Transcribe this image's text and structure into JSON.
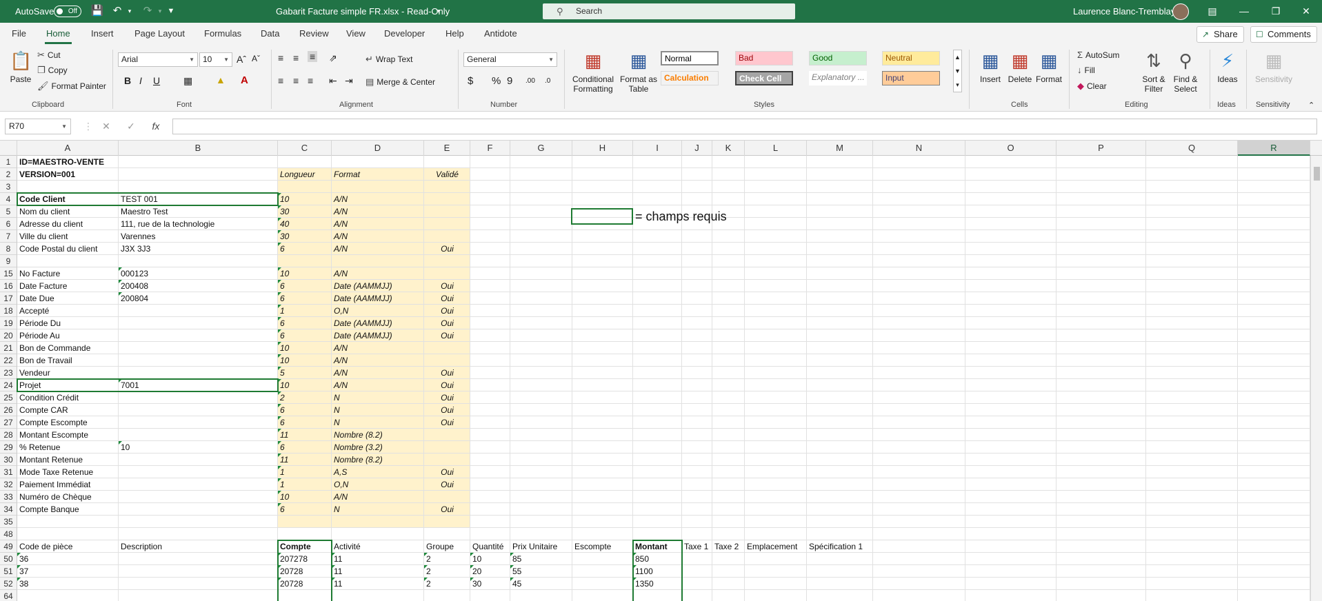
{
  "titlebar": {
    "autosave_label": "AutoSave",
    "autosave_state": "Off",
    "file_title": "Gabarit Facture simple FR.xlsx  -  Read-Only",
    "search_placeholder": "Search",
    "user_name": "Laurence Blanc-Tremblay"
  },
  "menu": {
    "tabs": [
      "File",
      "Home",
      "Insert",
      "Page Layout",
      "Formulas",
      "Data",
      "Review",
      "View",
      "Developer",
      "Help",
      "Antidote"
    ],
    "active": "Home",
    "share_label": "Share",
    "comments_label": "Comments"
  },
  "ribbon": {
    "clipboard": {
      "paste": "Paste",
      "cut": "Cut",
      "copy": "Copy",
      "format_painter": "Format Painter",
      "label": "Clipboard"
    },
    "font": {
      "family": "Arial",
      "size": "10",
      "label": "Font",
      "bold": "B",
      "italic": "I",
      "underline": "U"
    },
    "alignment": {
      "wrap_text": "Wrap Text",
      "merge_center": "Merge & Center",
      "label": "Alignment"
    },
    "number": {
      "format": "General",
      "label": "Number",
      "currency": "$",
      "percent": "%",
      "comma": "9",
      "inc_dec": ".00",
      "dec_dec": ".0"
    },
    "styles": {
      "conditional_formatting": "Conditional Formatting",
      "format_as_table": "Format as Table",
      "cells": [
        {
          "name": "Normal",
          "bg": "#ffffff",
          "color": "#000000"
        },
        {
          "name": "Bad",
          "bg": "#ffc7ce",
          "color": "#9c0006"
        },
        {
          "name": "Good",
          "bg": "#c6efce",
          "color": "#006100"
        },
        {
          "name": "Neutral",
          "bg": "#ffeb9c",
          "color": "#9c5700"
        },
        {
          "name": "Calculation",
          "bg": "#f2f2f2",
          "color": "#fa7d00"
        },
        {
          "name": "Check Cell",
          "bg": "#a5a5a5",
          "color": "#ffffff"
        },
        {
          "name": "Explanatory ...",
          "bg": "#ffffff",
          "color": "#7f7f7f"
        },
        {
          "name": "Input",
          "bg": "#ffcc99",
          "color": "#3f3f76"
        }
      ],
      "label": "Styles"
    },
    "cells": {
      "insert": "Insert",
      "delete": "Delete",
      "format": "Format",
      "label": "Cells"
    },
    "editing": {
      "autosum": "AutoSum",
      "fill": "Fill",
      "clear": "Clear",
      "sort_filter": "Sort & Filter",
      "find_select": "Find & Select",
      "label": "Editing"
    },
    "ideas": {
      "ideas": "Ideas",
      "label": "Ideas"
    },
    "sensitivity": {
      "sensitivity": "Sensitivity",
      "label": "Sensitivity"
    }
  },
  "formula_bar": {
    "name_box": "R70",
    "formula": ""
  },
  "columns": [
    "A",
    "B",
    "C",
    "D",
    "E",
    "F",
    "G",
    "H",
    "I",
    "J",
    "K",
    "L",
    "M",
    "N",
    "O",
    "P",
    "Q",
    "R"
  ],
  "selected_column": "R",
  "rows": [
    {
      "n": "1",
      "a": "ID=MAESTRO-VENTE",
      "ab": true
    },
    {
      "n": "2",
      "a": "VERSION=001",
      "ab": true,
      "c": "Longueur",
      "d": "Format",
      "e": "Validé"
    },
    {
      "n": "3"
    },
    {
      "n": "4",
      "a": "Code Client",
      "ab": true,
      "b": "TEST 001",
      "c": "10",
      "d": "A/N"
    },
    {
      "n": "5",
      "a": "Nom du client",
      "b": "Maestro Test",
      "c": "30",
      "d": "A/N"
    },
    {
      "n": "6",
      "a": "Adresse du client",
      "b": "111, rue de la technologie",
      "c": "40",
      "d": "A/N"
    },
    {
      "n": "7",
      "a": "Ville du client",
      "b": "Varennes",
      "c": "30",
      "d": "A/N"
    },
    {
      "n": "8",
      "a": "Code Postal du client",
      "b": "J3X 3J3",
      "c": "6",
      "d": "A/N",
      "e": "Oui"
    },
    {
      "n": "9"
    },
    {
      "n": "15",
      "a": "No Facture",
      "b": "000123",
      "bt": true,
      "c": "10",
      "d": "A/N"
    },
    {
      "n": "16",
      "a": "Date Facture",
      "b": "200408",
      "bt": true,
      "c": "6",
      "d": "Date (AAMMJJ)",
      "e": "Oui"
    },
    {
      "n": "17",
      "a": "Date Due",
      "b": "200804",
      "bt": true,
      "c": "6",
      "d": "Date (AAMMJJ)",
      "e": "Oui"
    },
    {
      "n": "18",
      "a": "Accepté",
      "c": "1",
      "d": "O,N",
      "e": "Oui"
    },
    {
      "n": "19",
      "a": "Période Du",
      "c": "6",
      "d": "Date (AAMMJJ)",
      "e": "Oui"
    },
    {
      "n": "20",
      "a": "Période Au",
      "c": "6",
      "d": "Date (AAMMJJ)",
      "e": "Oui"
    },
    {
      "n": "21",
      "a": "Bon de Commande",
      "c": "10",
      "d": "A/N"
    },
    {
      "n": "22",
      "a": "Bon de Travail",
      "c": "10",
      "d": "A/N"
    },
    {
      "n": "23",
      "a": "Vendeur",
      "c": "5",
      "d": "A/N",
      "e": "Oui"
    },
    {
      "n": "24",
      "a": "Projet",
      "b": "7001",
      "bt": true,
      "c": "10",
      "d": "A/N",
      "e": "Oui"
    },
    {
      "n": "25",
      "a": "Condition Crédit",
      "c": "2",
      "d": "N",
      "e": "Oui"
    },
    {
      "n": "26",
      "a": "Compte CAR",
      "c": "6",
      "d": "N",
      "e": "Oui"
    },
    {
      "n": "27",
      "a": "Compte Escompte",
      "c": "6",
      "d": "N",
      "e": "Oui"
    },
    {
      "n": "28",
      "a": "Montant Escompte",
      "c": "11",
      "d": "Nombre (8.2)"
    },
    {
      "n": "29",
      "a": "% Retenue",
      "b": "10",
      "bt": true,
      "c": "6",
      "d": "Nombre (3.2)"
    },
    {
      "n": "30",
      "a": "Montant Retenue",
      "c": "11",
      "d": "Nombre (8.2)"
    },
    {
      "n": "31",
      "a": "Mode Taxe Retenue",
      "c": "1",
      "d": "A,S",
      "e": "Oui"
    },
    {
      "n": "32",
      "a": "Paiement Immédiat",
      "c": "1",
      "d": "O,N",
      "e": "Oui"
    },
    {
      "n": "33",
      "a": "Numéro de Chèque",
      "c": "10",
      "d": "A/N"
    },
    {
      "n": "34",
      "a": "Compte Banque",
      "c": "6",
      "d": "N",
      "e": "Oui"
    },
    {
      "n": "35"
    },
    {
      "n": "48"
    },
    {
      "n": "49",
      "a": "Code de pièce",
      "b": "Description",
      "c": "Compte",
      "cb": true,
      "d": "Activité",
      "e": "Groupe",
      "f": "Quantité",
      "g": "Prix Unitaire",
      "h": "Escompte",
      "i": "Montant",
      "ib": true,
      "j": "Taxe 1",
      "k": "Taxe 2",
      "l": "Emplacement",
      "m": "Spécification 1"
    },
    {
      "n": "50",
      "a": "36",
      "at": true,
      "c": "207278",
      "ct": true,
      "d": "11",
      "dt": true,
      "e": "2",
      "et": true,
      "f": "10",
      "ft": true,
      "g": "85",
      "gt": true,
      "i": "850",
      "it": true
    },
    {
      "n": "51",
      "a": "37",
      "at": true,
      "c": "20728",
      "ct": true,
      "d": "11",
      "dt": true,
      "e": "2",
      "et": true,
      "f": "20",
      "ft": true,
      "g": "55",
      "gt": true,
      "i": "1100",
      "it": true
    },
    {
      "n": "52",
      "a": "38",
      "at": true,
      "c": "20728",
      "ct": true,
      "d": "11",
      "dt": true,
      "e": "2",
      "et": true,
      "f": "30",
      "ft": true,
      "g": "45",
      "gt": true,
      "i": "1350",
      "it": true
    },
    {
      "n": "64"
    }
  ],
  "legend": {
    "text": "= champs requis"
  }
}
